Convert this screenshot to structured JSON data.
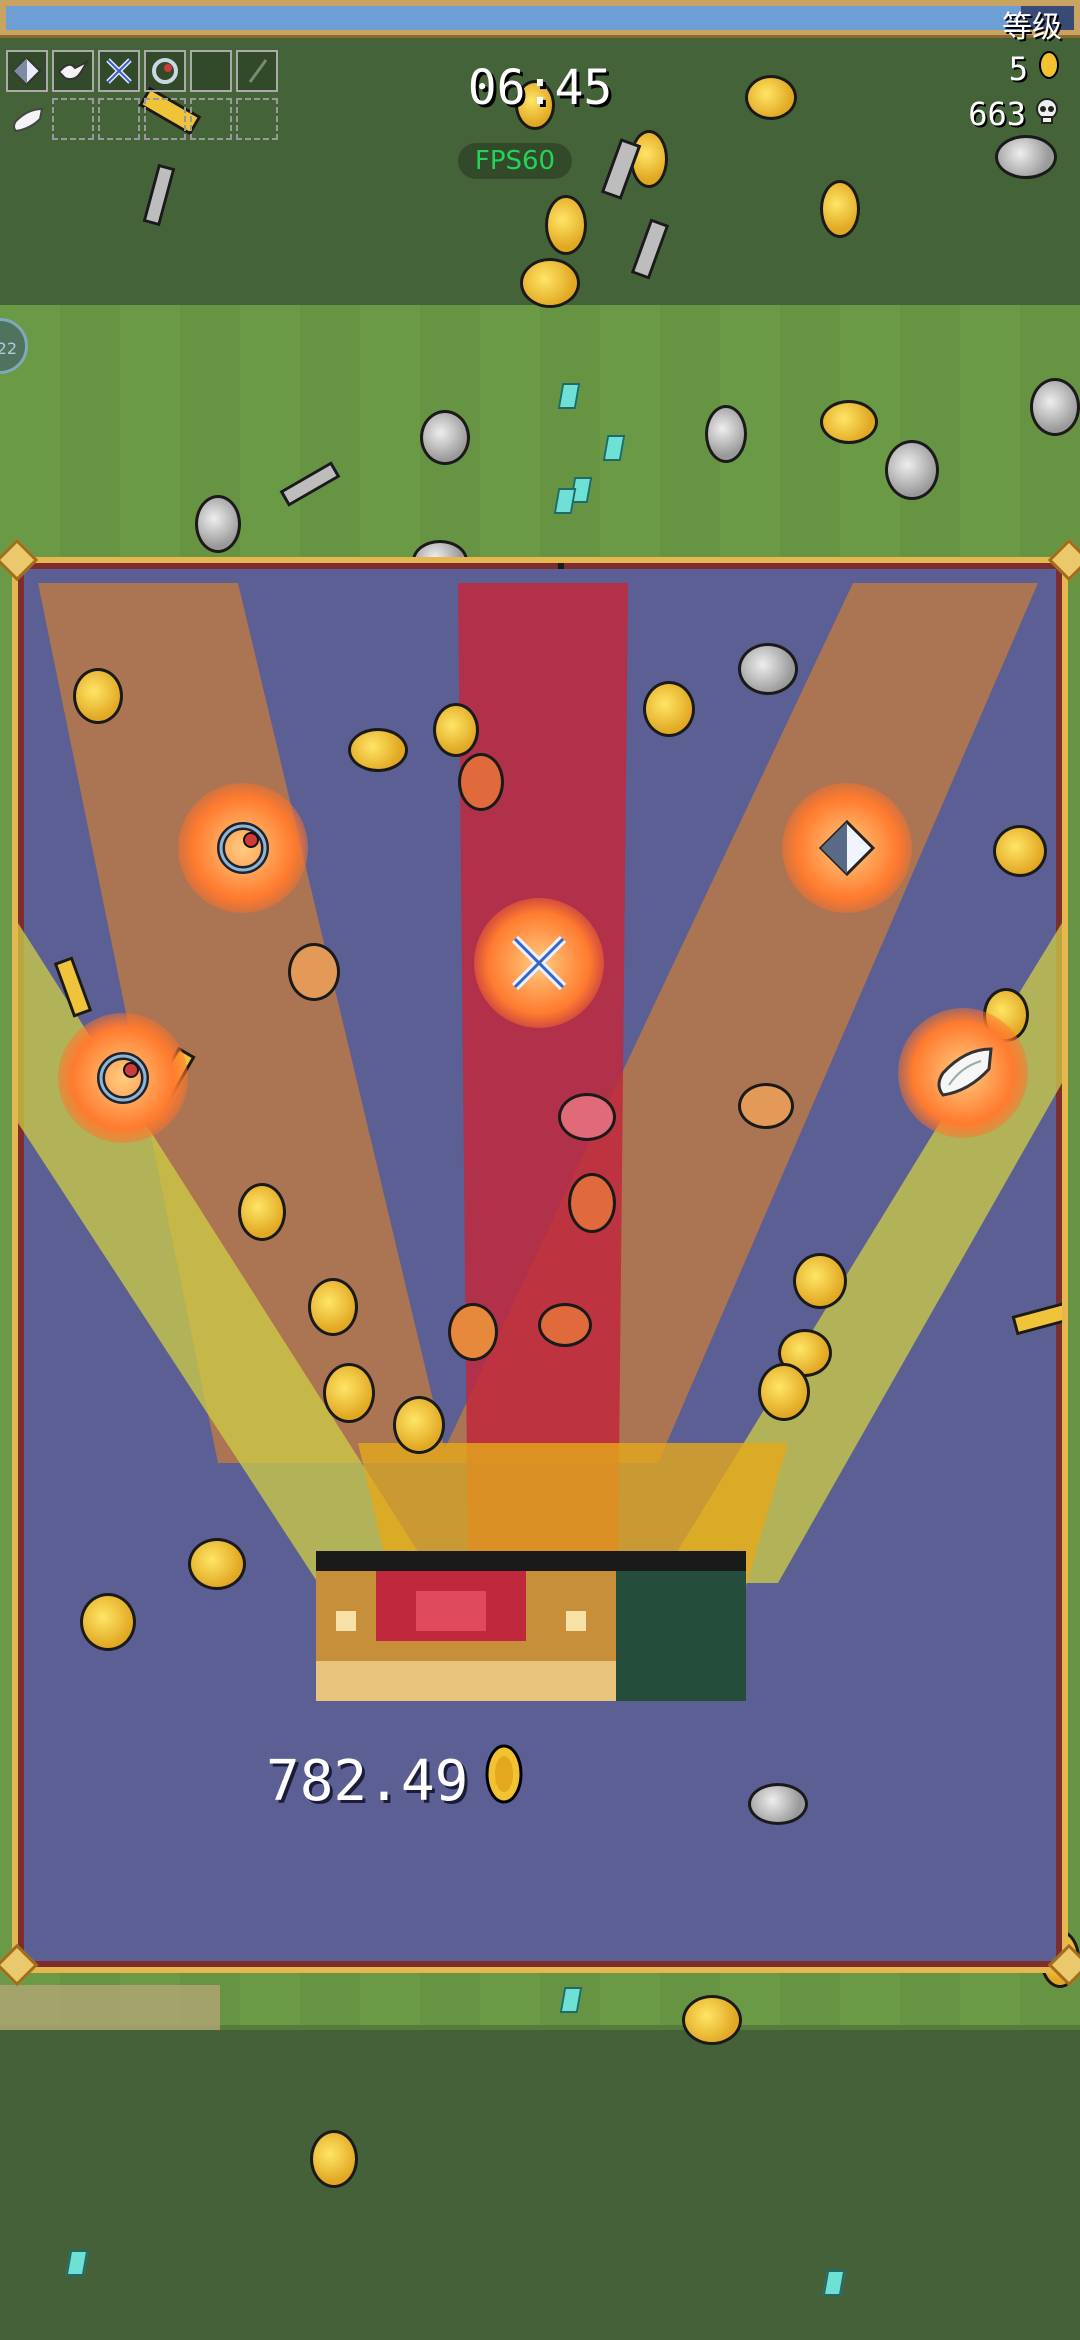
{
  "hud": {
    "level_label": "等级",
    "xp_fraction": 0.95,
    "timer": "06:45",
    "fps": "FPS60",
    "gold_count": "5",
    "kill_count": "663",
    "side_button_label": "22"
  },
  "weapon_slots": [
    {
      "icon": "diamond-shard-icon"
    },
    {
      "icon": "dove-icon"
    },
    {
      "icon": "crossed-blades-icon"
    },
    {
      "icon": "clock-lancet-icon"
    },
    {
      "icon": "empty-slot-icon"
    },
    {
      "icon": "empty-slot-icon"
    }
  ],
  "passive_slots": [
    {
      "icon": "wings-icon"
    }
  ],
  "chest": {
    "amount": "782.49",
    "rewards": [
      {
        "icon": "clock-lancet-icon"
      },
      {
        "icon": "clock-lancet-icon"
      },
      {
        "icon": "crossed-blades-icon"
      },
      {
        "icon": "diamond-shard-icon"
      },
      {
        "icon": "wings-icon"
      }
    ]
  },
  "colors": {
    "popup_bg": "#5c5f93",
    "popup_border": "#e7b74f",
    "xp_fill": "#6d9fd6",
    "fps_text": "#25d35b"
  }
}
